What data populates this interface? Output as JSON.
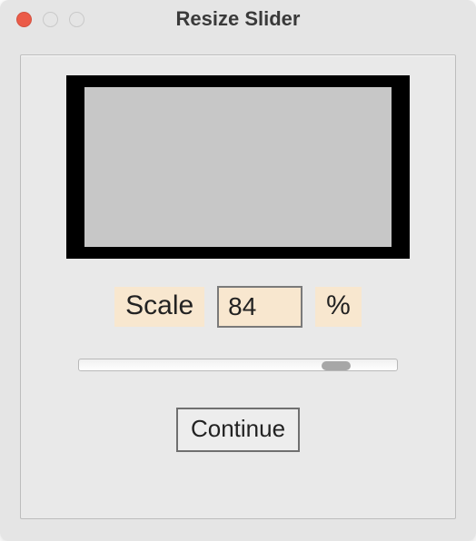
{
  "window": {
    "title": "Resize Slider"
  },
  "scale": {
    "label": "Scale",
    "value": "84",
    "unit": "%"
  },
  "slider": {
    "min": 0,
    "max": 100,
    "value": 84
  },
  "actions": {
    "continue_label": "Continue"
  }
}
